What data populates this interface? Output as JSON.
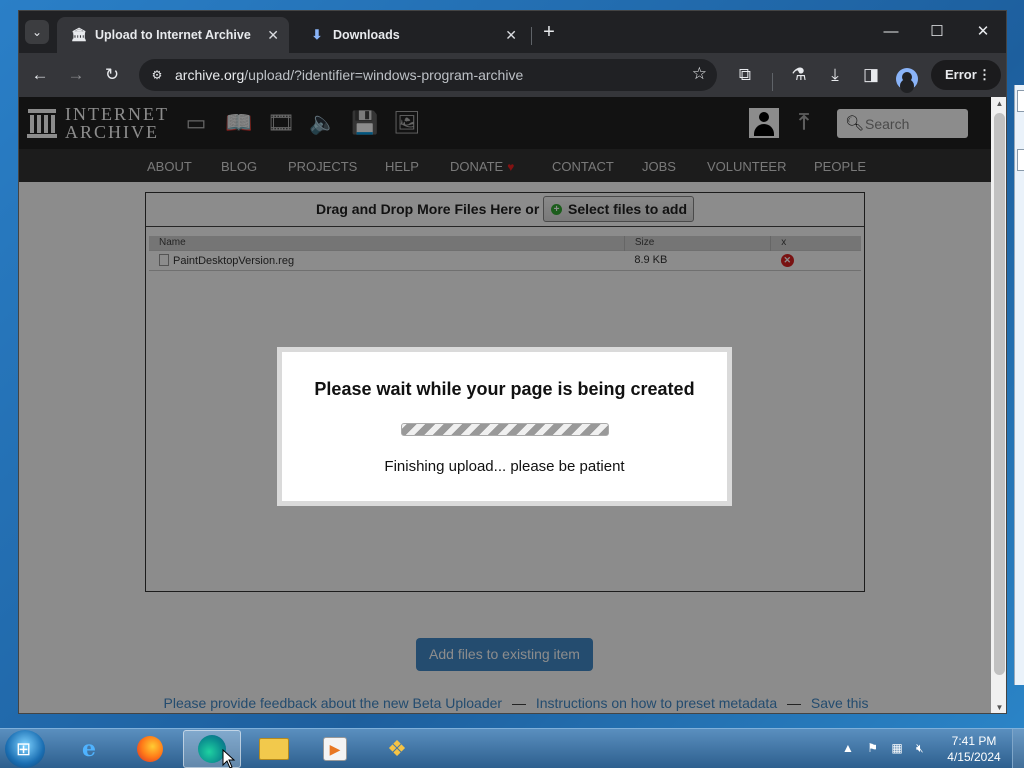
{
  "browser": {
    "tabs": [
      {
        "title": "Upload to Internet Archive",
        "active": true,
        "icon": "archive-icon"
      },
      {
        "title": "Downloads",
        "active": false,
        "icon": "download-icon"
      }
    ],
    "url_host": "archive.org",
    "url_path": "/upload/?identifier=windows-program-archive",
    "error_label": "Error"
  },
  "site": {
    "wordmark_line1": "INTERNET",
    "wordmark_line2": "ARCHIVE",
    "search_placeholder": "Search",
    "nav": [
      "ABOUT",
      "BLOG",
      "PROJECTS",
      "HELP",
      "DONATE",
      "CONTACT",
      "JOBS",
      "VOLUNTEER",
      "PEOPLE"
    ],
    "media_icons": [
      "web-icon",
      "texts-icon",
      "video-icon",
      "audio-icon",
      "software-icon",
      "images-icon"
    ]
  },
  "uploader": {
    "drop_text": "Drag and Drop More Files Here or",
    "select_button": "Select files to add",
    "columns": {
      "name": "Name",
      "size": "Size",
      "remove": "x"
    },
    "files": [
      {
        "name": "PaintDesktopVersion.reg",
        "size": "8.9 KB"
      }
    ],
    "add_existing_button": "Add files to existing item",
    "feedback_link": "Please provide feedback about the new Beta Uploader",
    "separator": "—",
    "instructions_link": "Instructions on how to preset metadata",
    "save_link": "Save this metadata"
  },
  "modal": {
    "title": "Please wait while your page is being created",
    "message": "Finishing upload... please be patient"
  },
  "taskbar": {
    "time": "7:41 PM",
    "date": "4/15/2024",
    "apps": [
      "internet-explorer-icon",
      "firefox-icon",
      "edge-icon",
      "file-explorer-icon",
      "media-player-icon",
      "windows-logo-icon"
    ]
  }
}
